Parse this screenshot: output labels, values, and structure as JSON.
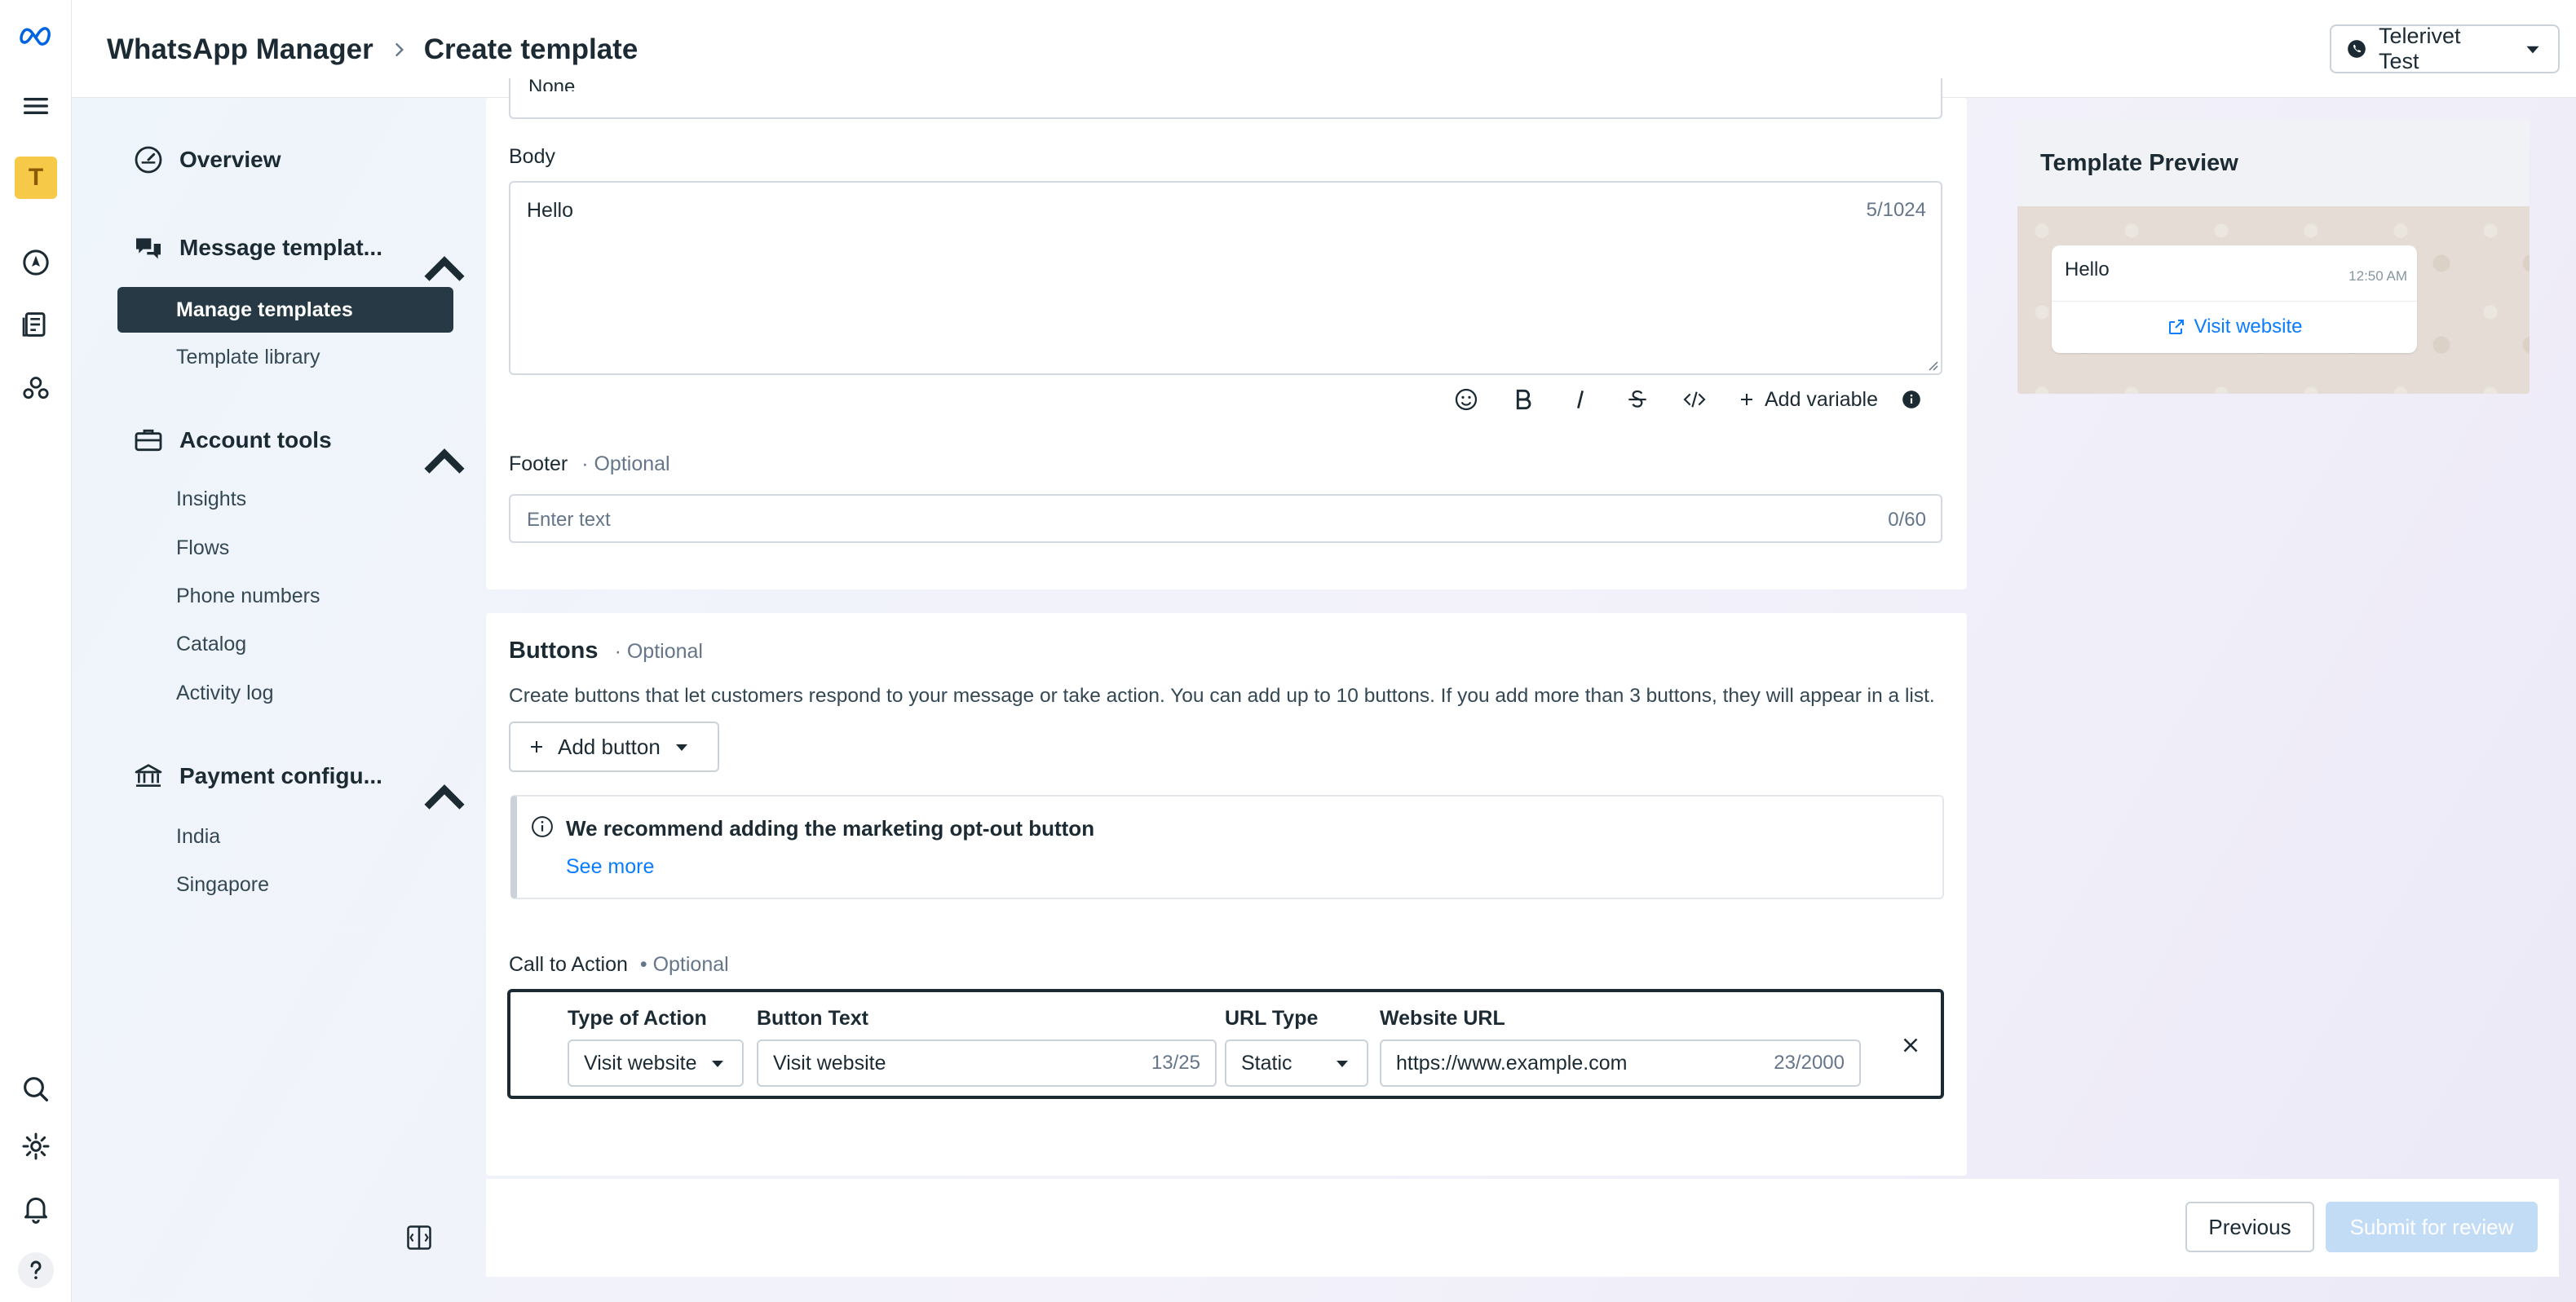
{
  "header": {
    "app_title": "WhatsApp Manager",
    "page_title": "Create template",
    "account_name": "Telerivet Test"
  },
  "sidebar": {
    "overview": "Overview",
    "message_templates": "Message templat...",
    "manage_templates": "Manage templates",
    "template_library": "Template library",
    "account_tools": "Account tools",
    "account_items": [
      "Insights",
      "Flows",
      "Phone numbers",
      "Catalog",
      "Activity log"
    ],
    "payment_config": "Payment configu...",
    "payment_items": [
      "India",
      "Singapore"
    ]
  },
  "rail": {
    "avatar_letter": "T"
  },
  "form": {
    "header_value": "None",
    "body_label": "Body",
    "body_value": "Hello",
    "body_counter": "5/1024",
    "add_variable": "Add variable",
    "footer_label": "Footer",
    "footer_optional": "· Optional",
    "footer_placeholder": "Enter text",
    "footer_counter": "0/60"
  },
  "buttons_section": {
    "title": "Buttons",
    "optional": "· Optional",
    "description": "Create buttons that let customers respond to your message or take action. You can add up to 10 buttons. If you add more than 3 buttons, they will appear in a list.",
    "add_button": "Add button",
    "banner_title": "We recommend adding the marketing opt-out button",
    "banner_link": "See more",
    "cta_label": "Call to Action",
    "cta_optional": "• Optional",
    "cta": {
      "type_label": "Type of Action",
      "type_value": "Visit website",
      "text_label": "Button Text",
      "text_value": "Visit website",
      "text_counter": "13/25",
      "url_type_label": "URL Type",
      "url_type_value": "Static",
      "url_label": "Website URL",
      "url_value": "https://www.example.com",
      "url_counter": "23/2000"
    }
  },
  "footer_bar": {
    "previous": "Previous",
    "submit": "Submit for review"
  },
  "preview": {
    "title": "Template Preview",
    "message": "Hello",
    "time": "12:50 AM",
    "button": "Visit website"
  },
  "colors": {
    "accent": "#0a7cff",
    "nav_active_bg": "#263945",
    "submit_disabled_bg": "#c3dcf6",
    "meta_blue": "#0064e0"
  }
}
